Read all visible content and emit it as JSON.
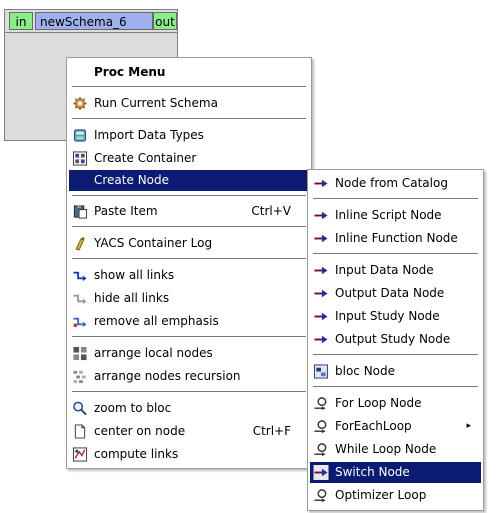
{
  "schema": {
    "in_port": "in",
    "title": "newSchema_6",
    "out_port": "out"
  },
  "main_menu": {
    "title": "Proc Menu",
    "run": "Run Current Schema",
    "import_types": "Import Data Types",
    "create_container": "Create Container",
    "create_node": "Create Node",
    "paste_item": "Paste Item",
    "paste_shortcut": "Ctrl+V",
    "container_log": "YACS Container Log",
    "show_links": "show all links",
    "hide_links": "hide all links",
    "remove_emphasis": "remove all emphasis",
    "arrange_local": "arrange local nodes",
    "arrange_recursion": "arrange nodes recursion",
    "zoom_bloc": "zoom to bloc",
    "center_node": "center on node",
    "center_shortcut": "Ctrl+F",
    "compute_links": "compute links"
  },
  "sub_menu": {
    "catalog": "Node from Catalog",
    "inline_script": "Inline Script Node",
    "inline_function": "Inline Function Node",
    "input_data": "Input Data Node",
    "output_data": "Output Data Node",
    "input_study": "Input Study Node",
    "output_study": "Output Study Node",
    "bloc": "bloc Node",
    "for_loop": "For Loop Node",
    "foreach_loop": "ForEachLoop",
    "while_loop": "While Loop Node",
    "switch": "Switch Node",
    "optimizer": "Optimizer Loop"
  },
  "colors": {
    "highlight": "#0b1a73",
    "port_green": "#88ee88",
    "title_blue": "#9fb0ee",
    "schema_grey": "#dcdcdc"
  }
}
